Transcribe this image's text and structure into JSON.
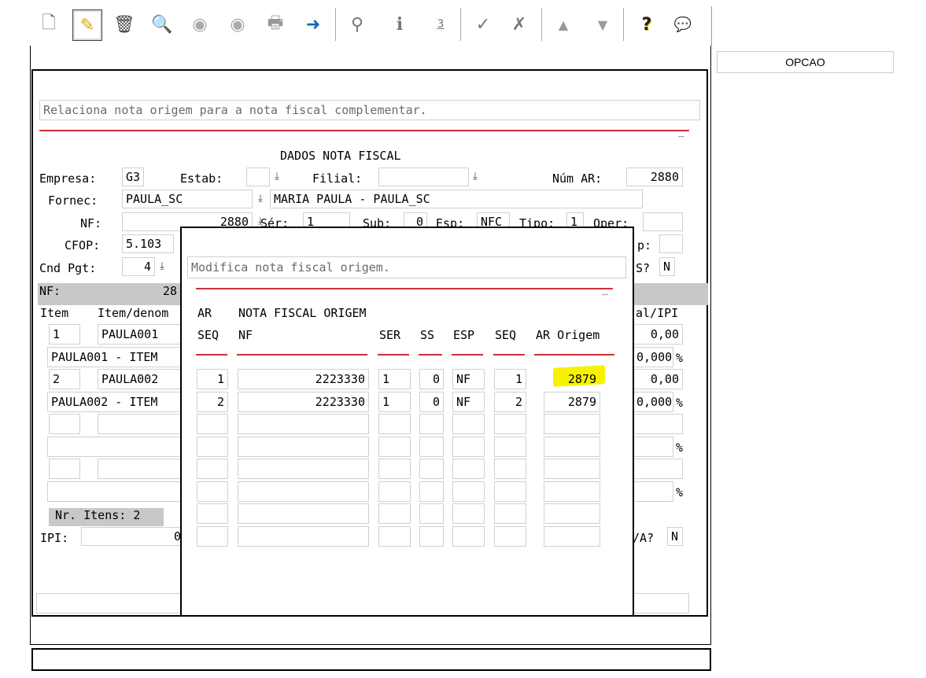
{
  "toolbar": {
    "icons": [
      "new-doc-icon",
      "edit-pencil-icon",
      "trash-icon",
      "search-icon",
      "prev-icon",
      "next-icon",
      "print-icon",
      "exit-icon",
      "binoculars-icon",
      "info-icon",
      "numbers-icon",
      "check-icon",
      "cancel-icon",
      "up-icon",
      "down-icon",
      "help-icon",
      "chat-icon"
    ],
    "glyphs": {
      "new": "🗋",
      "edit": "✎",
      "trash": "🗑",
      "search": "🔍",
      "prev": "◉",
      "next": "◉",
      "print": "🖶",
      "exit": "➜",
      "binoculars": "⚲",
      "info": "i",
      "numbers": "3",
      "check": "✓",
      "cancel": "✗",
      "up": "▲",
      "down": "▼",
      "help": "?",
      "chat": "💬"
    }
  },
  "opcao_button": "OPCAO",
  "main": {
    "hint": "Relaciona nota origem para a nota fiscal complementar.",
    "section_title": "DADOS NOTA FISCAL",
    "labels": {
      "empresa": "Empresa:",
      "estab": "Estab:",
      "filial": "Filial:",
      "num_ar": "Núm AR:",
      "fornec": "Fornec:",
      "nf": "NF:",
      "ser": "Sér:",
      "sub": "Sub:",
      "esp": "Esp:",
      "tipo": "Tipo:",
      "oper": "Oper:",
      "cfop": "CFOP:",
      "p": "p:",
      "cnd_pgt": "Cnd Pgt:",
      "s_q": "S?",
      "nf_bar": "NF:",
      "nf_bar_val": "28",
      "item": "Item",
      "item_denom": "Item/denom",
      "al_ipi": "al/IPI",
      "ipi": "IPI:",
      "a_q": "/A?"
    },
    "values": {
      "empresa": "G3",
      "estab": "",
      "filial": "",
      "num_ar": "2880",
      "fornec_code": "PAULA_SC",
      "fornec_name": "MARIA PAULA - PAULA_SC",
      "nf": "2880",
      "ser": "1",
      "sub": "0",
      "esp": "NFC",
      "tipo": "1",
      "oper": "",
      "cfop": "5.103",
      "cnd_pgt": "4",
      "s_flag": "N",
      "a_flag": "N",
      "ipi": "0"
    },
    "items": [
      {
        "num": "1",
        "code": "PAULA001",
        "desc": "PAULA001 - ITEM",
        "val": "0,00",
        "pct": "0,000"
      },
      {
        "num": "2",
        "code": "PAULA002",
        "desc": "PAULA002 - ITEM",
        "val": "0,00",
        "pct": "0,000"
      }
    ],
    "pct_sign": "%",
    "nr_itens": "Nr. Itens: 2"
  },
  "dialog": {
    "hint": "Modifica nota fiscal origem.",
    "headers": {
      "ar": "AR",
      "nfo": "NOTA FISCAL ORIGEM",
      "seq": "SEQ",
      "nf": "NF",
      "ser": "SER",
      "ss": "SS",
      "esp": "ESP",
      "seq2": "SEQ",
      "ar_origem": "AR Origem"
    },
    "rows": [
      {
        "seq": "1",
        "nf": "2223330",
        "ser": "1",
        "ss": "0",
        "esp": "NF",
        "seq2": "1",
        "ar_origem": "2879"
      },
      {
        "seq": "2",
        "nf": "2223330",
        "ser": "1",
        "ss": "0",
        "esp": "NF",
        "seq2": "2",
        "ar_origem": "2879"
      }
    ],
    "highlight_color": "#f7f200"
  }
}
